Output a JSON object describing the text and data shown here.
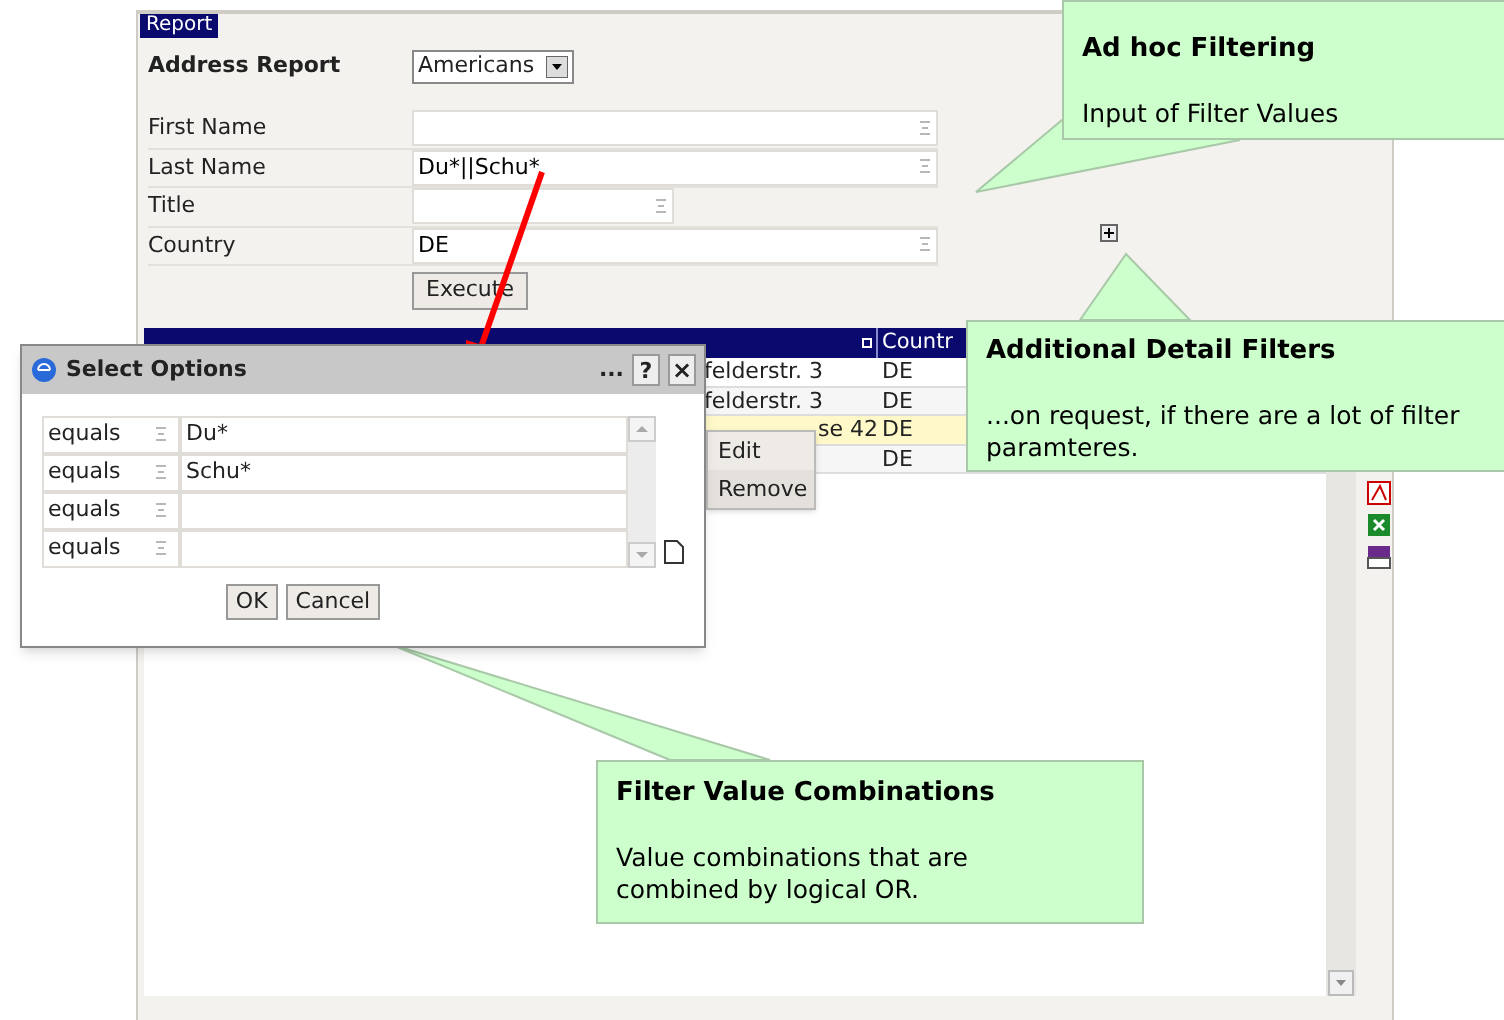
{
  "report": {
    "tab": "Report",
    "title": "Address Report",
    "variant": "Americans",
    "fields": [
      {
        "label": "First Name"
      },
      {
        "label": "Last Name",
        "value": "Du*||Schu*"
      },
      {
        "label": "Title",
        "short": true
      },
      {
        "label": "Country",
        "value": "DE"
      }
    ],
    "execute": "Execute"
  },
  "table": {
    "columns": [
      "Countr"
    ],
    "rows": [
      {
        "street": "felderstr. 3",
        "country": "DE",
        "selected": false
      },
      {
        "street": "felderstr. 3",
        "country": "DE",
        "selected": false
      },
      {
        "street": "se 42",
        "country": "DE",
        "selected": true
      },
      {
        "country": "DE",
        "selected": false
      }
    ]
  },
  "context_menu": [
    "Edit",
    "Remove"
  ],
  "dialog": {
    "title": "Select Options",
    "more": "...",
    "help": "?",
    "close": "×",
    "rows": [
      {
        "operator": "equals",
        "value": "Du*"
      },
      {
        "operator": "equals",
        "value": "Schu*"
      },
      {
        "operator": "equals"
      },
      {
        "operator": "equals"
      }
    ],
    "buttons": [
      "OK",
      "Cancel"
    ]
  },
  "callouts": [
    {
      "title": "Ad hoc Filtering",
      "text": "Input of Filter Values"
    },
    {
      "title": "Additional Detail Filters",
      "text": "...on request, if there are a lot of filter paramteres."
    },
    {
      "title": "Filter Value Combinations",
      "text": "Value combinations that are combined by logical OR."
    }
  ]
}
